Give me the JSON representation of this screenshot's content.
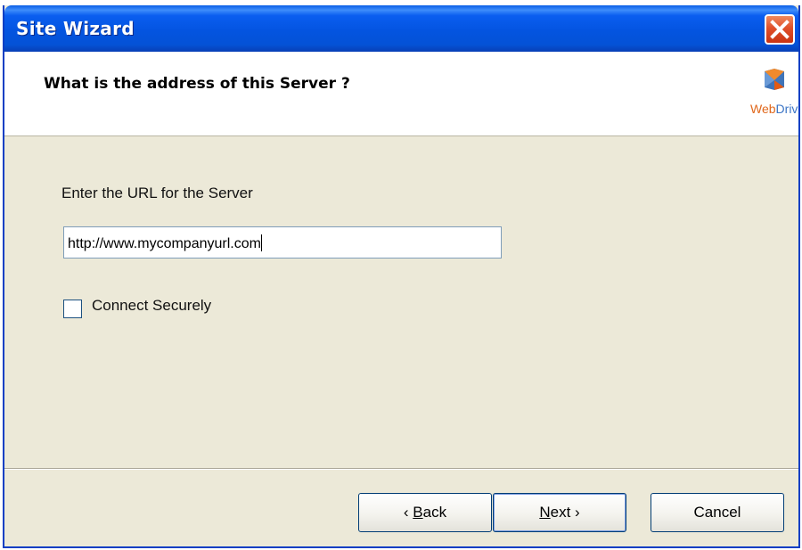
{
  "window": {
    "title": "Site Wizard"
  },
  "header": {
    "title": "What is the address of this Server ?"
  },
  "logo": {
    "text_part1": "Web",
    "text_part2": "Drive"
  },
  "form": {
    "url_label": "Enter the URL for the Server",
    "url_value": "http://www.mycompanyurl.com",
    "secure_label": "Connect Securely",
    "secure_checked": false
  },
  "buttons": {
    "back_prefix": "‹ ",
    "back_mnemonic": "B",
    "back_rest": "ack",
    "next_mnemonic": "N",
    "next_rest": "ext ›",
    "cancel": "Cancel"
  },
  "colors": {
    "titlebar": "#0454e0",
    "close": "#e0502a",
    "dialog_bg": "#ece9d8"
  },
  "icons": {
    "close": "close-x-icon",
    "logo": "webdrive-logo-icon"
  }
}
